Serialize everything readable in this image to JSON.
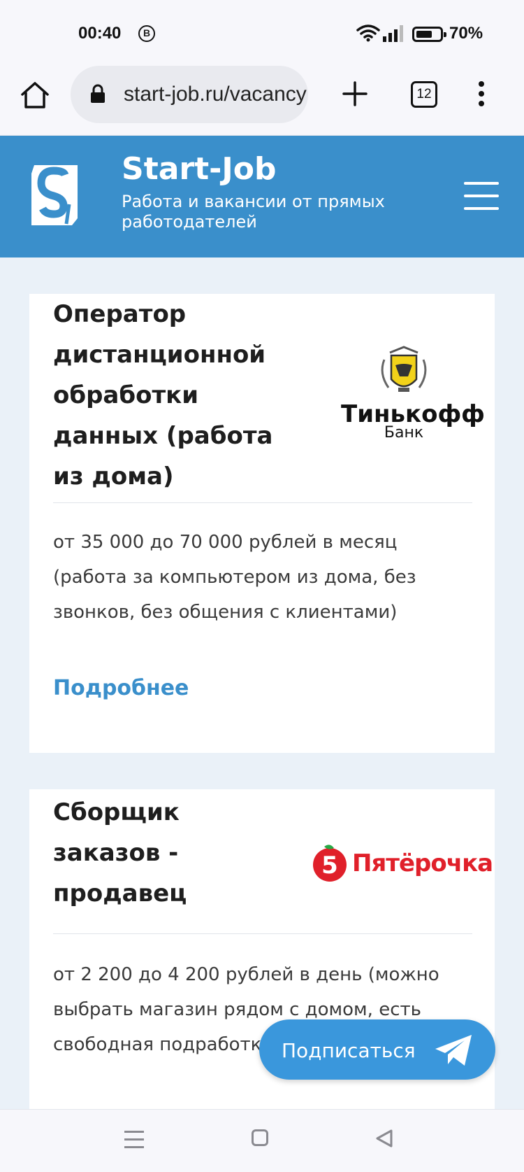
{
  "status_bar": {
    "time": "00:40",
    "notification_icon_letter": "B",
    "battery_percent": "70%",
    "battery_level": 0.7
  },
  "browser": {
    "url": "start-job.ru/vacancy",
    "tab_count": "12"
  },
  "site": {
    "title": "Start-Job",
    "subtitle": "Работа и вакансии от прямых работодателей",
    "brand_color": "#3a8fcb"
  },
  "vacancies": [
    {
      "title": "Оператор дистанционной обработки данных (работа из дома)",
      "employer_logo": {
        "name": "Тинькофф",
        "sub": "Банк"
      },
      "description": "от 35 000 до 70 000 рублей в месяц (работа за компьютером из дома, без звонков, без общения с клиентами)",
      "more_label": "Подробнее"
    },
    {
      "title": "Сборщик заказов - продавец",
      "employer_logo": {
        "name": "Пятёрочка",
        "badge": "5"
      },
      "description": "от 2 200 до 4 200 рублей в день (можно выбрать магазин рядом с домом, есть свободная подработка)"
    }
  ],
  "subscribe": {
    "label": "Подписаться"
  },
  "nav_icons": [
    "menu-icon",
    "home-icon",
    "back-icon"
  ]
}
